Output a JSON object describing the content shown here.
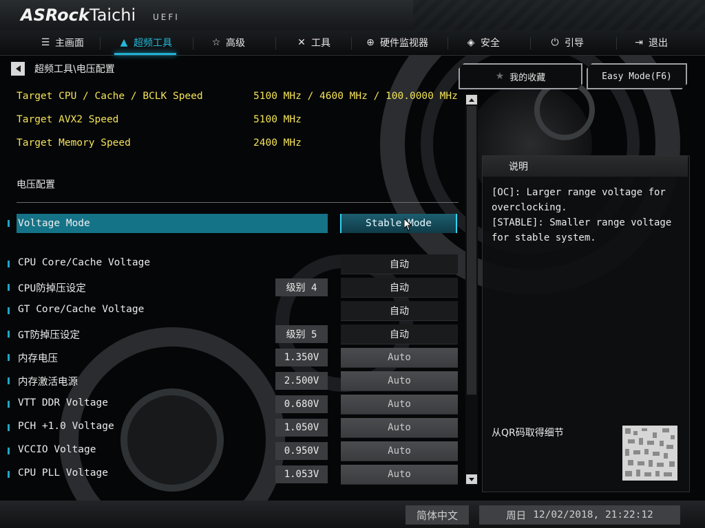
{
  "brand": {
    "name": "ASRock",
    "series": "Taichi",
    "firmware": "UEFI"
  },
  "tabs": [
    {
      "label": "主画面",
      "icon": "list-icon"
    },
    {
      "label": "超频工具",
      "icon": "flame-icon"
    },
    {
      "label": "高级",
      "icon": "star-icon"
    },
    {
      "label": "工具",
      "icon": "tools-icon"
    },
    {
      "label": "硬件监视器",
      "icon": "crosshair-icon"
    },
    {
      "label": "安全",
      "icon": "shield-icon"
    },
    {
      "label": "引导",
      "icon": "power-icon"
    },
    {
      "label": "退出",
      "icon": "exit-icon"
    }
  ],
  "breadcrumb": "超频工具\\电压配置",
  "targets": [
    {
      "label": "Target CPU / Cache / BCLK Speed",
      "value": "5100 MHz / 4600 MHz / 100.0000 MHz"
    },
    {
      "label": "Target AVX2 Speed",
      "value": "5100 MHz"
    },
    {
      "label": "Target Memory Speed",
      "value": "2400 MHz"
    }
  ],
  "section_title": "电压配置",
  "voltage_mode": {
    "label": "Voltage Mode",
    "option": "Stable Mode"
  },
  "settings": [
    {
      "label": "CPU Core/Cache Voltage",
      "current": "",
      "option": "自动"
    },
    {
      "label": "CPU防掉压设定",
      "current": "级别 4",
      "option": "自动"
    },
    {
      "label": "GT Core/Cache Voltage",
      "current": "",
      "option": "自动"
    },
    {
      "label": "GT防掉压设定",
      "current": "级别 5",
      "option": "自动"
    },
    {
      "label": "内存电压",
      "current": "1.350V",
      "option": "Auto"
    },
    {
      "label": "内存激活电源",
      "current": "2.500V",
      "option": "Auto"
    },
    {
      "label": "VTT DDR Voltage",
      "current": "0.680V",
      "option": "Auto"
    },
    {
      "label": "PCH +1.0 Voltage",
      "current": "1.050V",
      "option": "Auto"
    },
    {
      "label": "VCCIO Voltage",
      "current": "0.950V",
      "option": "Auto"
    },
    {
      "label": "CPU PLL Voltage",
      "current": "1.053V",
      "option": "Auto"
    }
  ],
  "favorites_label": "我的收藏",
  "easy_mode_label": "Easy Mode(F6)",
  "description": {
    "title": "说明",
    "lines": [
      "[OC]: Larger range voltage for",
      "overclocking.",
      "[STABLE]: Smaller range voltage",
      "for stable system."
    ],
    "qr_label": "从QR码取得细节"
  },
  "footer": {
    "language": "简体中文",
    "weekday": "周日",
    "datetime": "12/02/2018, 21:22:12"
  },
  "colors": {
    "accent": "#1fb2d4",
    "target_text": "#f3e35a",
    "highlight_row": "#157387"
  }
}
